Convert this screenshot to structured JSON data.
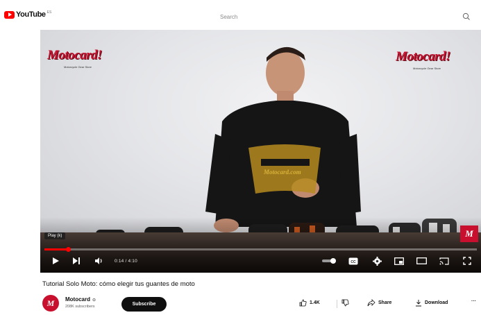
{
  "header": {
    "logo_text": "YouTube",
    "region_code": "ES",
    "search_placeholder": "Search"
  },
  "player": {
    "brand_left": "Motocard!",
    "brand_left_sub": "Motorcycle Gear Store",
    "brand_right": "Motocard!",
    "brand_right_sub": "Motorcycle Gear Store",
    "shirt_text": "Motocard.com",
    "tooltip": "Play (k)",
    "time": "0:14 / 4:10",
    "progress_fraction": 0.056,
    "badge": "M",
    "icons": [
      "play-icon",
      "next-icon",
      "volume-icon",
      "autoplay-toggle-icon",
      "captions-icon",
      "settings-icon",
      "miniplayer-icon",
      "theater-icon",
      "cast-icon",
      "fullscreen-icon"
    ]
  },
  "video": {
    "title": "Tutorial Solo Moto: cómo elegir tus guantes de moto"
  },
  "channel": {
    "avatar_text": "M",
    "name": "Motocard",
    "subscribers": "208K subscribers",
    "subscribe_label": "Subscribe"
  },
  "actions": {
    "likes": "1.4K",
    "share": "Share",
    "download": "Download",
    "more": "···"
  },
  "colors": {
    "accent": "#ff0000",
    "brand": "#c8102e",
    "button_dark": "#0f0f0f"
  }
}
